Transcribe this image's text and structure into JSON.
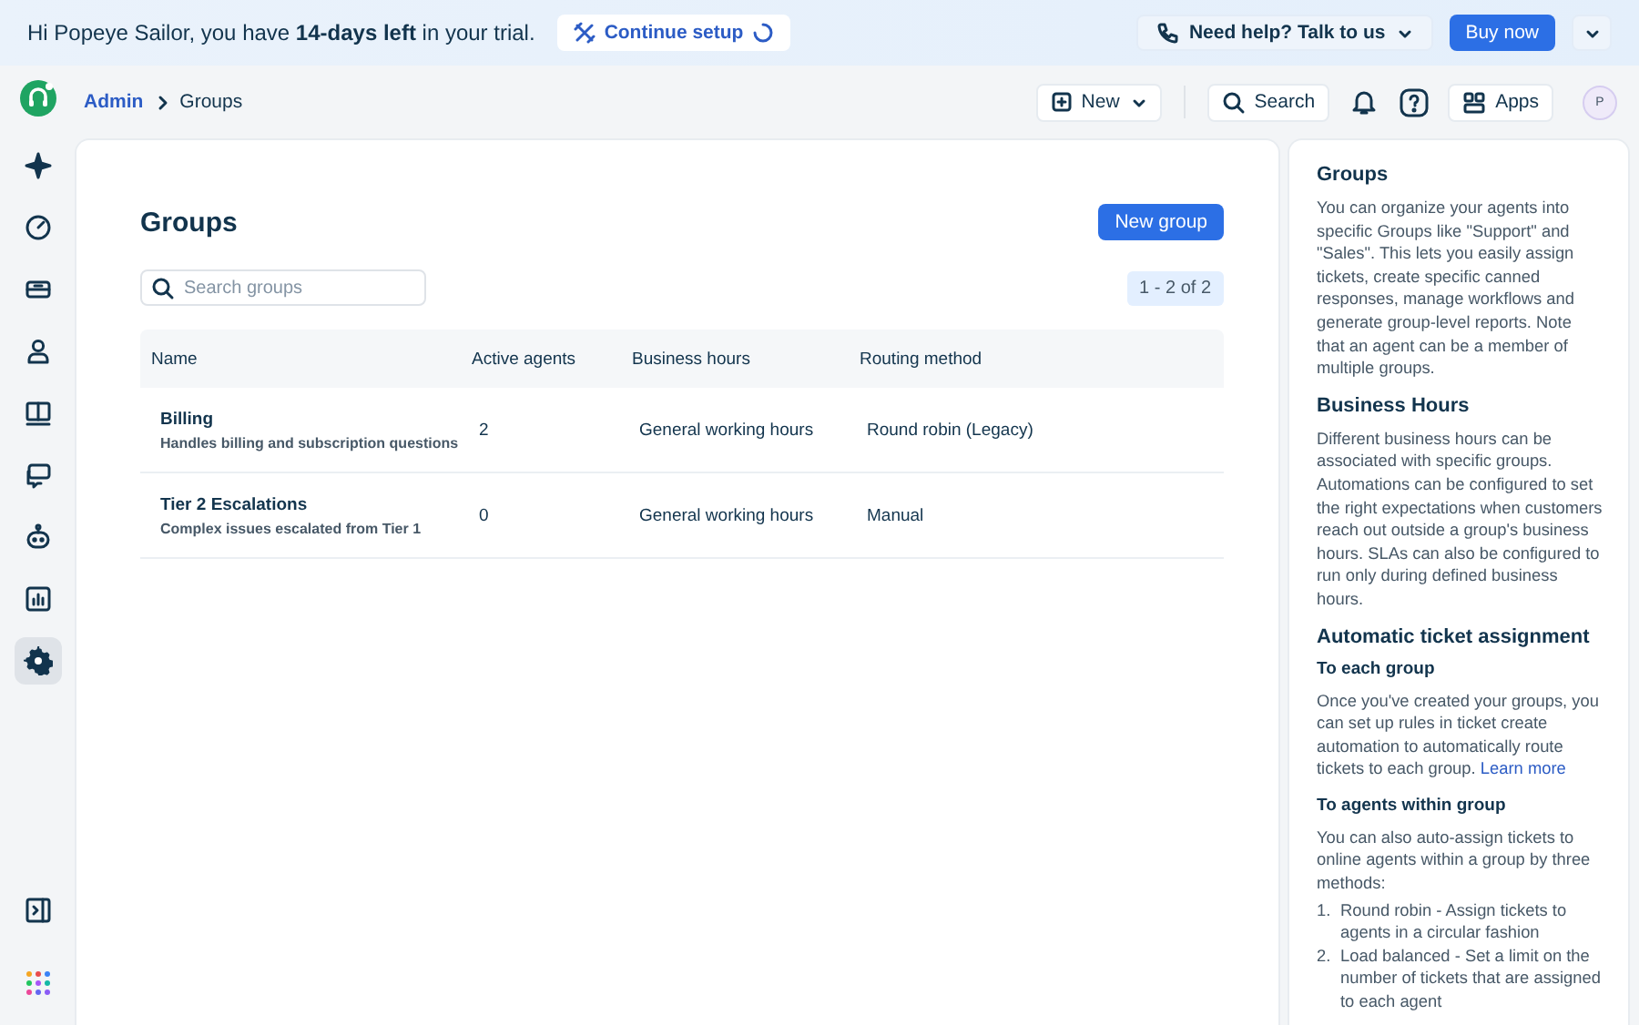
{
  "trial_banner": {
    "message": "Hi Popeye Sailor, you have **14-days left** in your trial.",
    "setup_button": "Continue setup",
    "help_button": "Need help? Talk to us",
    "buy_button": "Buy now"
  },
  "header": {
    "breadcrumb": [
      {
        "label": "Admin",
        "kind": "link"
      },
      {
        "label": "Groups",
        "kind": "current"
      }
    ],
    "new_button": "New",
    "search_button": "Search",
    "apps_button": "Apps",
    "avatar": "P"
  },
  "sidebar": {
    "items": [
      {
        "kind": "sparkle",
        "selected": false
      },
      {
        "kind": "gauge",
        "selected": false
      },
      {
        "kind": "ticket",
        "selected": false
      },
      {
        "kind": "contact",
        "selected": false
      },
      {
        "kind": "book",
        "selected": false
      },
      {
        "kind": "chat",
        "selected": false
      },
      {
        "kind": "bot",
        "selected": false
      },
      {
        "kind": "chart",
        "selected": false
      },
      {
        "kind": "gear",
        "selected": true
      }
    ],
    "bottom": [
      {
        "kind": "collapse"
      },
      {
        "kind": "apps"
      }
    ]
  },
  "page": {
    "title": "Groups",
    "new_group_button": "New group",
    "search": {
      "placeholder": "Search groups"
    },
    "pager": "1 - 2 of 2"
  },
  "table": {
    "columns": [
      "Name",
      "Active agents",
      "Business hours",
      "Routing method"
    ],
    "rows": [
      {
        "name": "Billing",
        "description": "Handles billing and subscription questions",
        "active_agents": "2",
        "business_hours": "General working hours",
        "routing_method": "Round robin (Legacy)"
      },
      {
        "name": "Tier 2 Escalations",
        "description": "Complex issues escalated from Tier 1",
        "active_agents": "0",
        "business_hours": "General working hours",
        "routing_method": "Manual"
      }
    ]
  },
  "help_panel": {
    "sections": [
      {
        "kind": "heading",
        "text": "Groups"
      },
      {
        "kind": "paragraph",
        "text": "You can organize your agents into specific Groups like \"Support\" and \"Sales\". This lets you easily assign tickets, create specific canned responses, manage workflows and generate group-level reports. Note that an agent can be a member of multiple groups."
      },
      {
        "kind": "heading",
        "text": "Business Hours"
      },
      {
        "kind": "paragraph",
        "text": "Different business hours can be associated with specific groups. Automations can be configured to set the right expectations when customers reach out outside a group's business hours. SLAs can also be configured to run only during defined business hours."
      },
      {
        "kind": "heading",
        "text": "Automatic ticket assignment"
      },
      {
        "kind": "subheading",
        "text": "To each group"
      },
      {
        "kind": "paragraph",
        "text": "Once you've created your groups, you can set up rules in ticket create automation to automatically route tickets to each group.",
        "link": "Learn more"
      },
      {
        "kind": "subheading",
        "text": "To agents within group"
      },
      {
        "kind": "paragraph",
        "text": "You can also auto-assign tickets to online agents within a group by three methods:"
      },
      {
        "kind": "list",
        "items": [
          {
            "number": "1.",
            "text": "Round robin - Assign tickets to agents in a circular fashion"
          },
          {
            "number": "2.",
            "text": "Load balanced - Set a limit on the number of tickets that are assigned to each agent"
          }
        ]
      }
    ]
  }
}
